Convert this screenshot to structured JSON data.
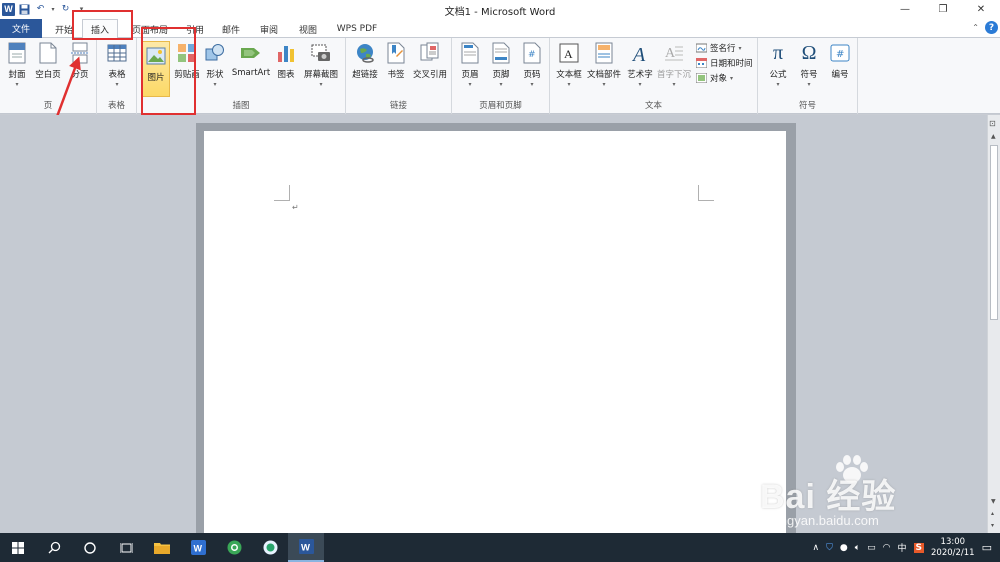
{
  "window": {
    "title": "文档1 - Microsoft Word",
    "logo": "W"
  },
  "tabs": [
    {
      "label": "文件"
    },
    {
      "label": "开始"
    },
    {
      "label": "插入"
    },
    {
      "label": "页面布局"
    },
    {
      "label": "引用"
    },
    {
      "label": "邮件"
    },
    {
      "label": "审阅"
    },
    {
      "label": "视图"
    },
    {
      "label": "WPS PDF"
    }
  ],
  "ribbon": {
    "pages_group": {
      "label": "页",
      "cover": "封面",
      "blank": "空白页",
      "break": "分页"
    },
    "tables_group": {
      "label": "表格",
      "table": "表格"
    },
    "illustrations_group": {
      "label": "插图",
      "picture": "图片",
      "clipart": "剪贴画",
      "shapes": "形状",
      "smartart": "SmartArt",
      "chart": "图表",
      "screenshot": "屏幕截图"
    },
    "links_group": {
      "label": "链接",
      "hyperlink": "超链接",
      "bookmark": "书签",
      "crossref": "交叉引用"
    },
    "header_footer_group": {
      "label": "页眉和页脚",
      "header": "页眉",
      "footer": "页脚",
      "pagenum": "页码"
    },
    "text_group": {
      "label": "文本",
      "textbox": "文本框",
      "quickparts": "文档部件",
      "wordart": "艺术字",
      "dropcap": "首字下沉",
      "signature": "签名行",
      "datetime": "日期和时间",
      "object": "对象"
    },
    "symbols_group": {
      "label": "符号",
      "equation": "公式",
      "symbol": "符号",
      "number": "编号"
    }
  },
  "watermark": {
    "main": "Bai 经验",
    "sub": "jingyan.baidu.com"
  },
  "taskbar": {
    "time": "13:00",
    "date": "2020/2/11",
    "ime": "中"
  },
  "colors": {
    "word_blue": "#2b579a",
    "annotation_red": "#e03030",
    "selected_yellow": "#fcd967"
  }
}
